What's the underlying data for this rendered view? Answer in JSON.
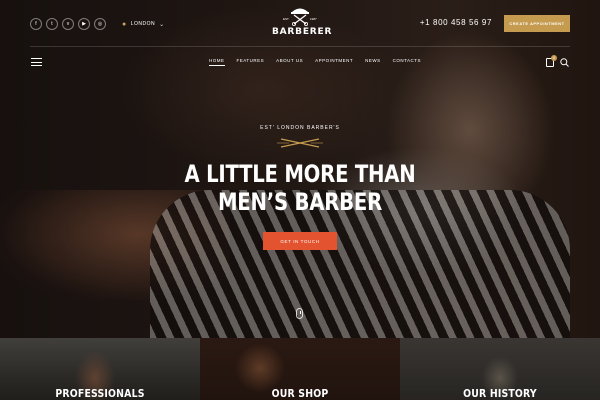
{
  "header": {
    "social_icons": [
      {
        "name": "facebook-icon",
        "glyph": "f"
      },
      {
        "name": "twitter-icon",
        "glyph": "t"
      },
      {
        "name": "vimeo-icon",
        "glyph": "v"
      },
      {
        "name": "youtube-icon",
        "glyph": "▶"
      },
      {
        "name": "instagram-icon",
        "glyph": "◎"
      }
    ],
    "location": "LONDON",
    "logo_small_left": "EST",
    "logo_small_right": "1987",
    "logo_text": "BARBERER",
    "phone": "+1 800 458 56 97",
    "appointment_button": "CREATE APPOINTMENT"
  },
  "nav": {
    "items": [
      {
        "label": "HOME",
        "active": true
      },
      {
        "label": "FEATURES",
        "active": false
      },
      {
        "label": "ABOUT US",
        "active": false
      },
      {
        "label": "APPOINTMENT",
        "active": false
      },
      {
        "label": "NEWS",
        "active": false
      },
      {
        "label": "CONTACTS",
        "active": false
      }
    ],
    "cart_count": "0"
  },
  "hero": {
    "eyebrow": "EST' LONDON BARBER'S",
    "headline_line1": "A LITTLE MORE THAN",
    "headline_line2": "MEN’S BARBER",
    "cta": "GET IN TOUCH"
  },
  "cards": [
    {
      "title": "PROFESSIONALS"
    },
    {
      "title": "OUR SHOP"
    },
    {
      "title": "OUR HISTORY"
    }
  ],
  "colors": {
    "accent_gold": "#c59b50",
    "accent_orange": "#e4532f"
  }
}
